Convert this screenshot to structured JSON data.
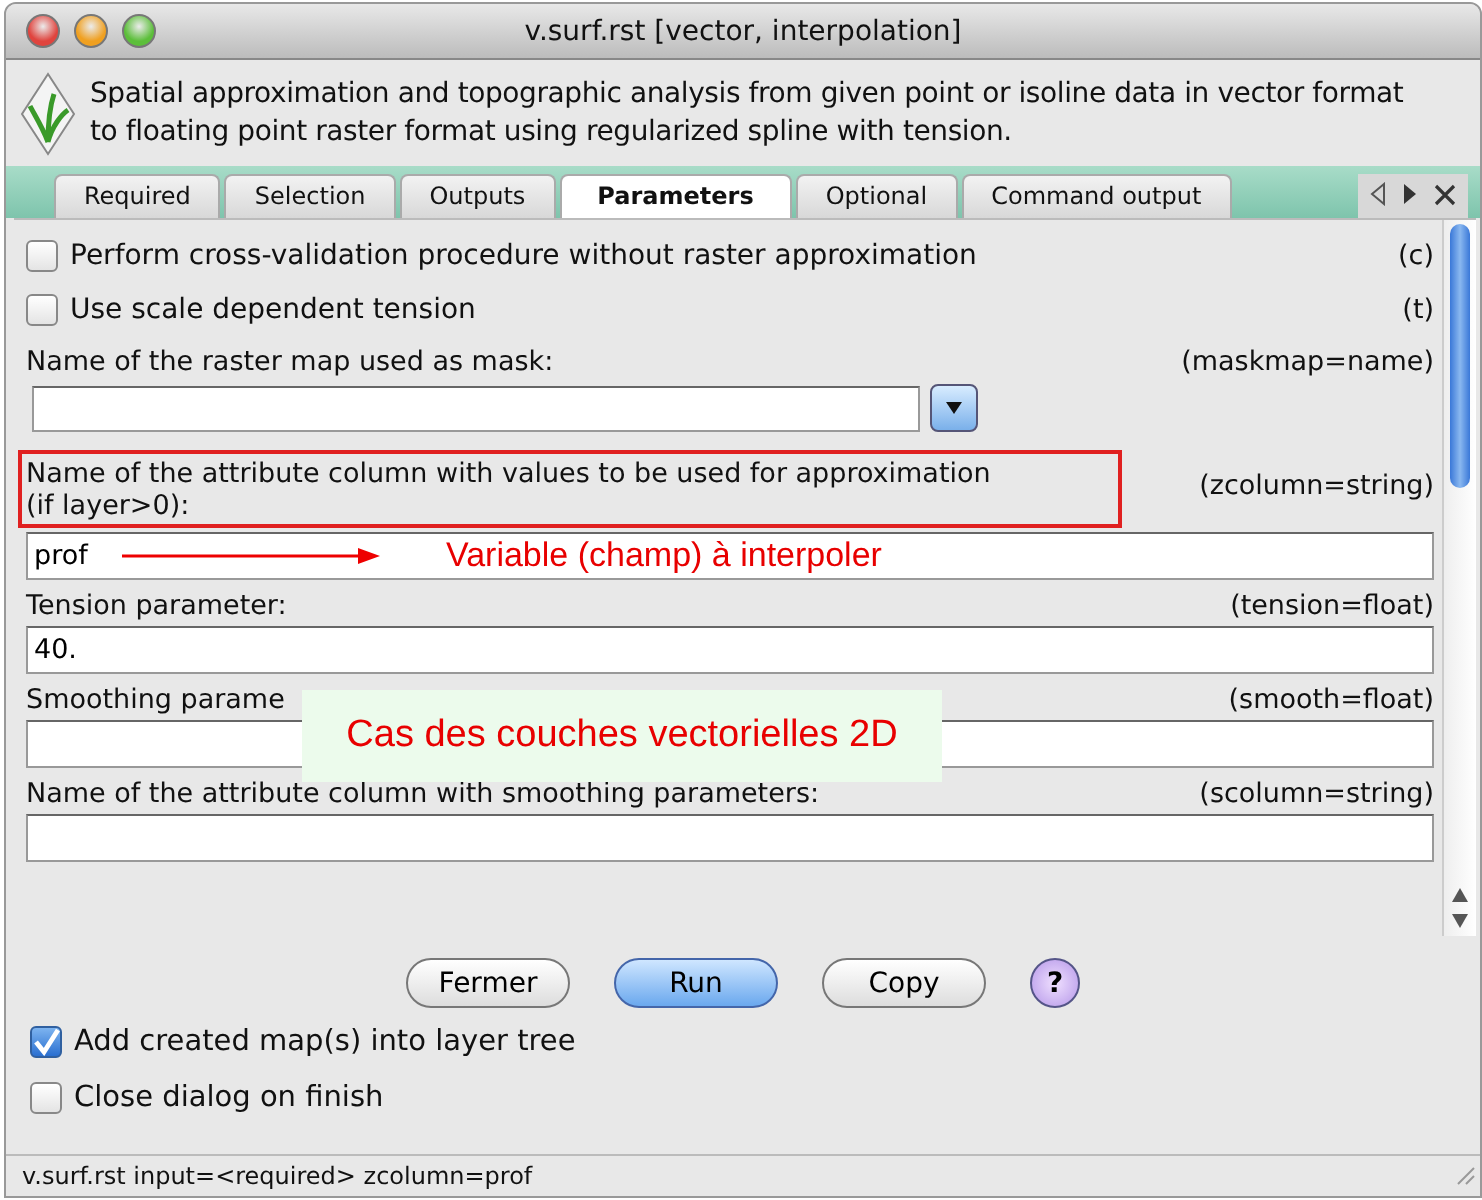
{
  "window": {
    "title": "v.surf.rst [vector, interpolation]"
  },
  "description": "Spatial approximation and topographic analysis from given point or isoline data in vector format to floating point raster format using regularized spline with tension.",
  "tabs": [
    {
      "label": "Required",
      "selected": false
    },
    {
      "label": "Selection",
      "selected": false
    },
    {
      "label": "Outputs",
      "selected": false
    },
    {
      "label": "Parameters",
      "selected": true
    },
    {
      "label": "Optional",
      "selected": false
    },
    {
      "label": "Command output",
      "selected": false
    }
  ],
  "parameters": [
    {
      "kind": "checkbox",
      "label": "Perform cross-validation procedure without raster approximation",
      "flag": "(c)",
      "checked": false
    },
    {
      "kind": "checkbox",
      "label": "Use scale dependent tension",
      "flag": "(t)",
      "checked": false
    },
    {
      "kind": "select",
      "label": "Name of the raster map used as mask:",
      "flag": "(maskmap=name)"
    },
    {
      "kind": "text",
      "label": "Name of the attribute column with values to be used for approximation (if layer>0):",
      "flag": "(zcolumn=string)",
      "value": "prof",
      "highlighted": true,
      "note": "Variable (champ) à interpoler"
    },
    {
      "kind": "text",
      "label": "Tension parameter:",
      "flag": "(tension=float)",
      "value": "40.",
      "highlighted": false
    },
    {
      "kind": "text",
      "label": "Smoothing parame",
      "flag": "(smooth=float)",
      "highlighted": false
    },
    {
      "kind": "text",
      "label": "Name of the attribute column with smoothing parameters:",
      "flag": "(scolumn=string)",
      "highlighted": false
    }
  ],
  "callout": {
    "text": "Cas des couches vectorielles 2D"
  },
  "buttons": [
    {
      "label": "Fermer",
      "kind": "plain"
    },
    {
      "label": "Run",
      "kind": "default"
    },
    {
      "label": "Copy",
      "kind": "plain"
    }
  ],
  "help": "?",
  "options": [
    {
      "label": "Add created map(s) into layer tree",
      "checked": true
    },
    {
      "label": "Close dialog on finish",
      "checked": false
    }
  ],
  "status_bar": "v.surf.rst input=<required> zcolumn=prof"
}
